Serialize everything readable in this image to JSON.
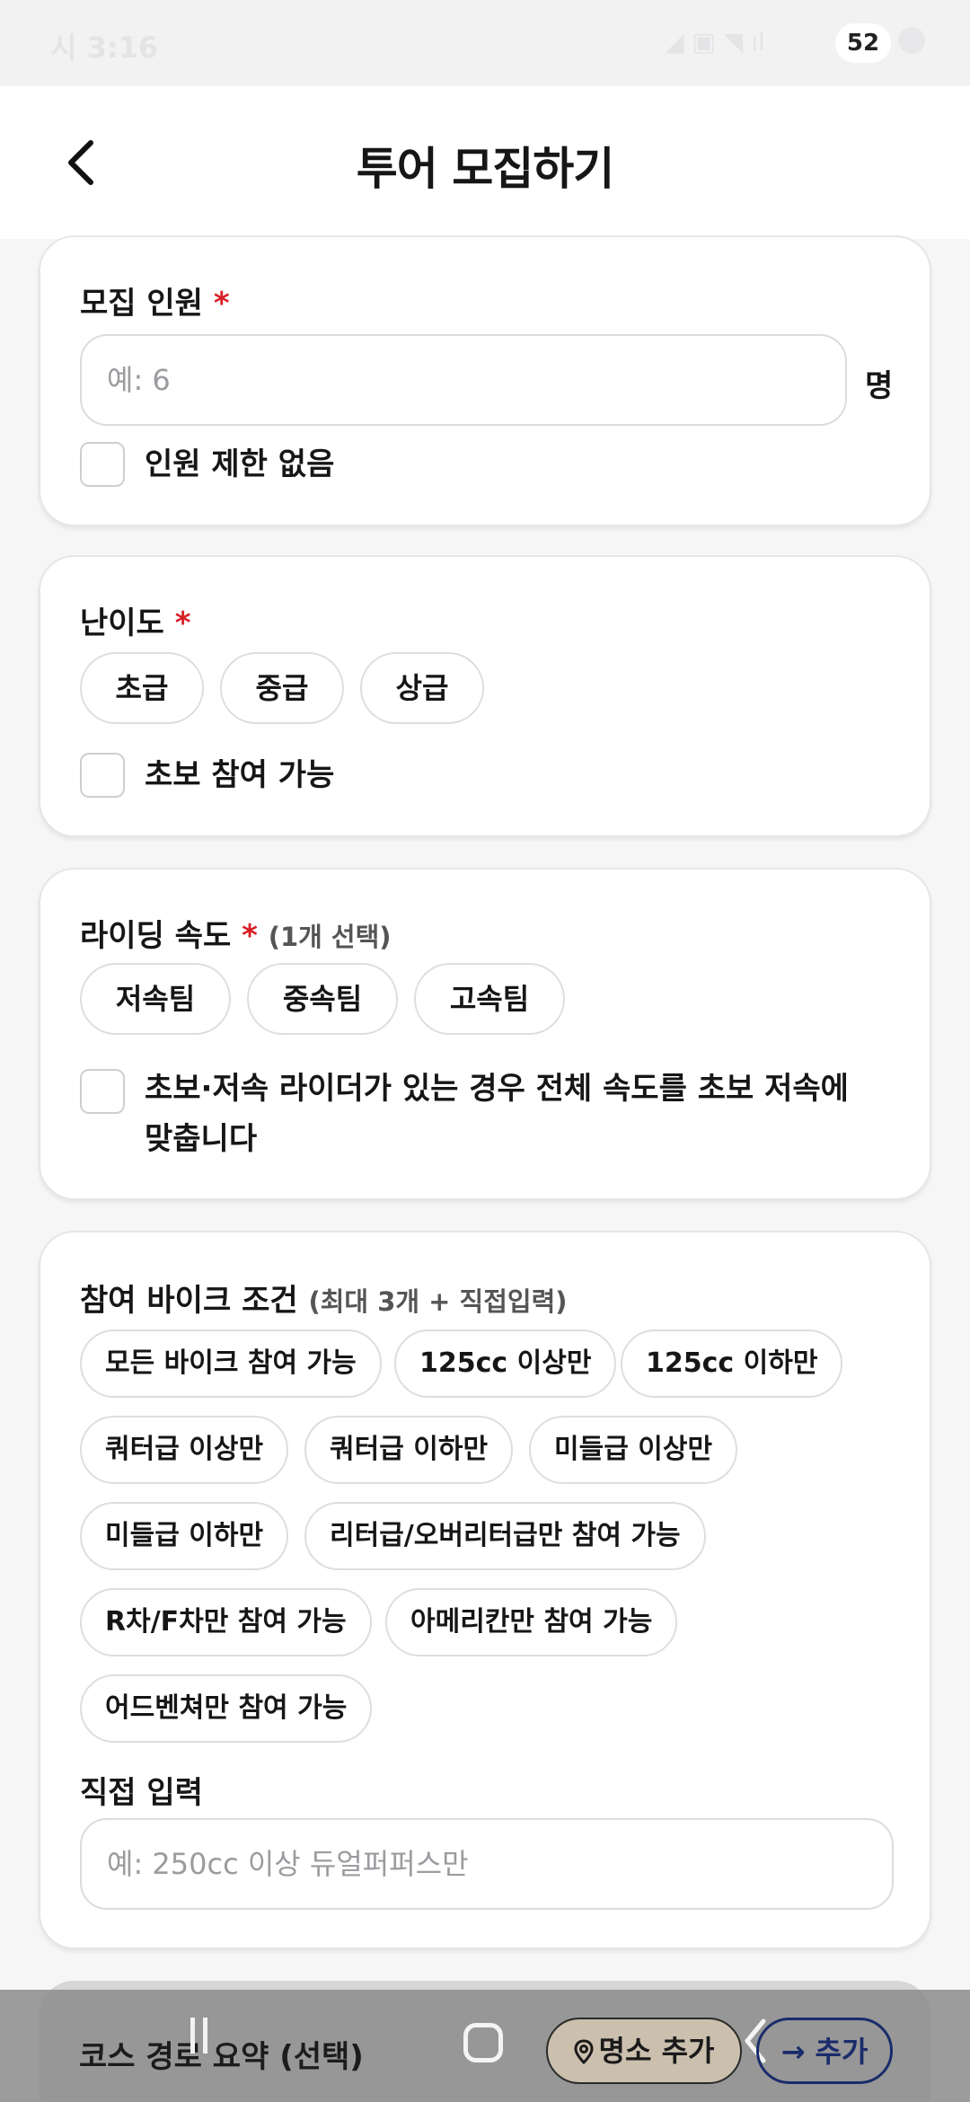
{
  "status_bar": {
    "time": "시 3:16",
    "battery": "52"
  },
  "header": {
    "title": "투어 모집하기"
  },
  "capacity": {
    "label": "모집 인원",
    "required_mark": "*",
    "placeholder": "예: 6",
    "unit": "명",
    "checkbox_label": "인원 제한 없음"
  },
  "difficulty": {
    "label": "난이도",
    "required_mark": "*",
    "options": [
      "초급",
      "중급",
      "상급"
    ],
    "checkbox_label": "초보 참여 가능"
  },
  "speed": {
    "label": "라이딩 속도",
    "required_mark": "*",
    "hint": "(1개 선택)",
    "options": [
      "저속팀",
      "중속팀",
      "고속팀"
    ],
    "checkbox_line1": "초보·저속 라이더가 있는 경우 전체 속도를 초보 저속에",
    "checkbox_line2": "맞춥니다"
  },
  "bike": {
    "label": "참여 바이크 조건",
    "hint": "(최대 3개 + 직접입력)",
    "options": [
      "모든 바이크 참여 가능",
      "125cc 이상만",
      "125cc 이하만",
      "쿼터급 이상만",
      "쿼터급 이하만",
      "미들급 이상만",
      "미들급 이하만",
      "리터급/오버리터급만 참여 가능",
      "R차/F차만 참여 가능",
      "아메리칸만 참여 가능",
      "어드벤쳐만 참여 가능"
    ],
    "custom_label": "직접 입력",
    "custom_placeholder": "예: 250cc 이상 듀얼퍼퍼스만"
  },
  "course": {
    "label": "코스 경로 요약 (선택)",
    "place_button": "명소 추가",
    "add_button": "→ 추가"
  }
}
